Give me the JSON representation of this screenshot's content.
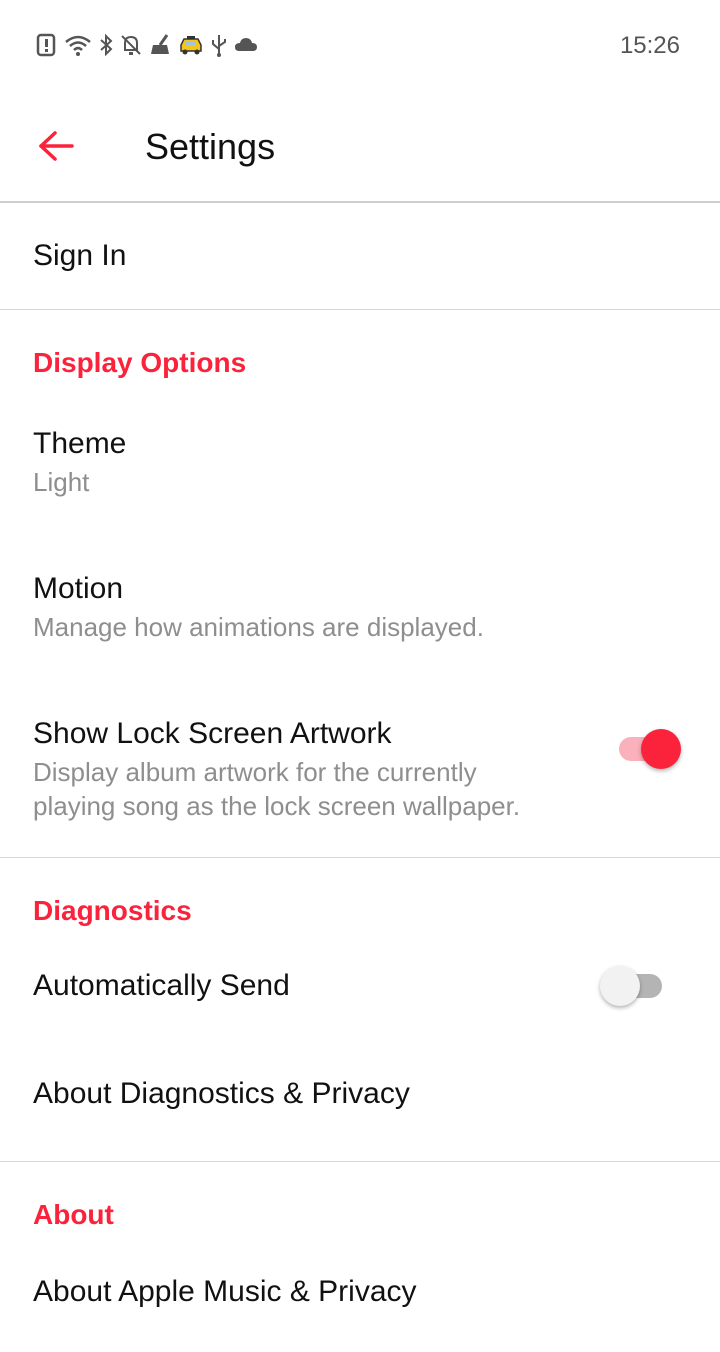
{
  "status_bar": {
    "time": "15:26",
    "icons": [
      "alert-icon",
      "wifi-icon",
      "bluetooth-icon",
      "notifications-off-icon",
      "cleaner-icon",
      "taxi-icon",
      "usb-icon",
      "cloud-icon"
    ]
  },
  "app_bar": {
    "title": "Settings",
    "back_icon": "arrow-back-icon"
  },
  "colors": {
    "accent": "#fa233b",
    "secondary_text": "#8e8e8e"
  },
  "settings": {
    "sign_in": "Sign In",
    "display_options": {
      "header": "Display Options",
      "theme": {
        "title": "Theme",
        "value": "Light"
      },
      "motion": {
        "title": "Motion",
        "subtitle": "Manage how animations are displayed."
      },
      "lock_screen": {
        "title": "Show Lock Screen Artwork",
        "subtitle_line1": "Display album artwork for the currently",
        "subtitle_line2": "playing song as the lock screen wallpaper.",
        "enabled": true
      }
    },
    "diagnostics": {
      "header": "Diagnostics",
      "auto_send": {
        "title": "Automatically Send",
        "enabled": false
      },
      "about": "About Diagnostics & Privacy"
    },
    "about": {
      "header": "About",
      "apple_music_privacy": "About Apple Music & Privacy"
    }
  }
}
